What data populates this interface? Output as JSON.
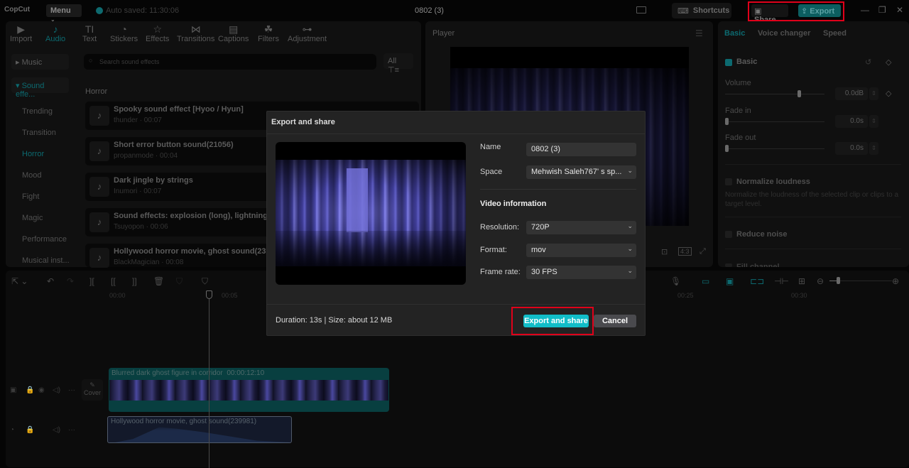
{
  "app": {
    "logo": "CopCut",
    "menu_label": "Menu",
    "autosave_text": "Auto saved: 11:30:06",
    "project_title": "0802 (3)",
    "shortcuts_label": "Shortcuts",
    "share_label": "Share",
    "export_label": "Export",
    "accent_color": "#11bdc8",
    "highlight_color": "#e0001a"
  },
  "media_toolbar": {
    "items": [
      {
        "label": "Import",
        "icon": "import-icon"
      },
      {
        "label": "Audio",
        "icon": "audio-icon",
        "active": true
      },
      {
        "label": "Text",
        "icon": "text-icon"
      },
      {
        "label": "Stickers",
        "icon": "stickers-icon"
      },
      {
        "label": "Effects",
        "icon": "effects-icon"
      },
      {
        "label": "Transitions",
        "icon": "transitions-icon"
      },
      {
        "label": "Captions",
        "icon": "captions-icon"
      },
      {
        "label": "Filters",
        "icon": "filters-icon"
      },
      {
        "label": "Adjustment",
        "icon": "adjustment-icon"
      }
    ]
  },
  "categories": {
    "music": "Music",
    "sound_effects": "Sound effe...",
    "items": [
      "Trending",
      "Transition",
      "Horror",
      "Mood",
      "Fight",
      "Magic",
      "Performance",
      "Musical inst..."
    ],
    "active": "Horror"
  },
  "search": {
    "placeholder": "Search sound effects",
    "filter_label": "All"
  },
  "section_label": "Horror",
  "sounds": [
    {
      "title": "Spooky sound effect [Hyoo / Hyun]",
      "sub": "thunder · 00:07"
    },
    {
      "title": "Short error button sound(21056)",
      "sub": "propanmode · 00:04"
    },
    {
      "title": "Dark jingle by strings",
      "sub": "Inumori · 00:07"
    },
    {
      "title": "Sound effects: explosion (long), lightning,",
      "sub": "Tsuyopon · 00:06"
    },
    {
      "title": "Hollywood horror movie, ghost sound(239",
      "sub": "BlackMagician · 00:08"
    }
  ],
  "player": {
    "title": "Player",
    "ratio_label": "4:3"
  },
  "properties": {
    "tabs": [
      "Basic",
      "Voice changer",
      "Speed"
    ],
    "active_tab": "Basic",
    "section": "Basic",
    "volume_label": "Volume",
    "volume_value": "0.0dB",
    "volume_level": 0.73,
    "fade_in_label": "Fade in",
    "fade_in_value": "0.0s",
    "fade_out_label": "Fade out",
    "fade_out_value": "0.0s",
    "normalize_label": "Normalize loudness",
    "normalize_desc": "Normalize the loudness of the selected clip or clips to a target level.",
    "reduce_noise_label": "Reduce noise",
    "fill_channel_label": "Fill channel"
  },
  "timeline": {
    "ruler": [
      "00:00",
      "00:05",
      "00:25",
      "00:30"
    ],
    "video_clip": {
      "label": "Blurred dark ghost figure in corridor",
      "duration": "00:00:12:10"
    },
    "audio_clip": {
      "label": "Hollywood horror movie, ghost sound(239981)"
    },
    "cover_label": "Cover"
  },
  "dialog": {
    "title": "Export and share",
    "name_label": "Name",
    "name_value": "0802 (3)",
    "space_label": "Space",
    "space_value": "Mehwish Saleh767'  s sp...",
    "video_info_title": "Video information",
    "resolution_label": "Resolution:",
    "resolution_value": "720P",
    "format_label": "Format:",
    "format_value": "mov",
    "framerate_label": "Frame rate:",
    "framerate_value": "30 FPS",
    "duration_text": "Duration: 13s | Size: about 12 MB",
    "export_button": "Export and share",
    "cancel_button": "Cancel"
  }
}
